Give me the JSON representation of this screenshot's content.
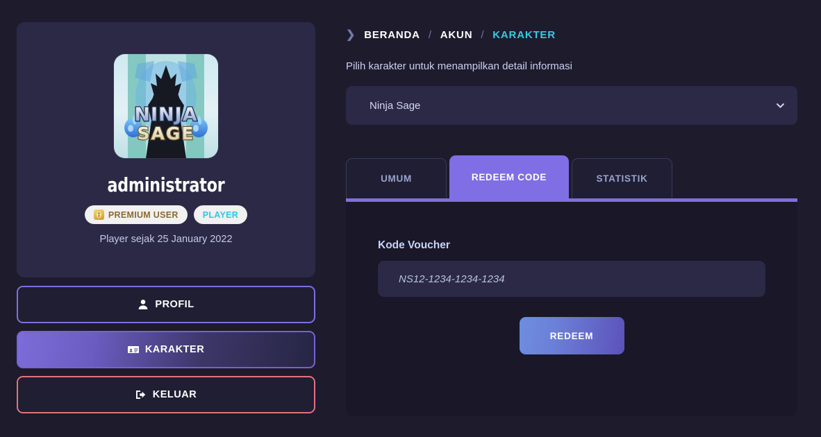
{
  "breadcrumb": {
    "chevron_icon": "chevron-right-icon",
    "items": [
      {
        "label": "BERANDA",
        "current": false
      },
      {
        "label": "AKUN",
        "current": false
      },
      {
        "label": "KARAKTER",
        "current": true
      }
    ],
    "separator": "/"
  },
  "profile": {
    "avatar_icon": "ninja-sage-game-avatar",
    "avatar_title_line1": "NINJA",
    "avatar_title_line2": "SAGE",
    "username": "administrator",
    "badges": [
      {
        "label": "PREMIUM USER",
        "icon": "gold-coin-icon",
        "color": "#8a6a34"
      },
      {
        "label": "PLAYER",
        "icon": "",
        "color": "#2fc6e8"
      }
    ],
    "since_text": "Player sejak 25 January 2022"
  },
  "nav": {
    "buttons": [
      {
        "label": "PROFIL",
        "icon": "user-icon",
        "state": "outline-purple"
      },
      {
        "label": "KARAKTER",
        "icon": "id-card-icon",
        "state": "active-purple"
      },
      {
        "label": "KELUAR",
        "icon": "sign-out-icon",
        "state": "outline-red"
      }
    ]
  },
  "main": {
    "helper_text": "Pilih karakter untuk menampilkan detail informasi",
    "character_select": {
      "selected": "Ninja Sage",
      "chevron_icon": "chevron-down-icon",
      "options": [
        "Ninja Sage"
      ]
    },
    "tabs": [
      {
        "label": "UMUM",
        "active": false
      },
      {
        "label": "REDEEM CODE",
        "active": true
      },
      {
        "label": "STATISTIK",
        "active": false
      }
    ],
    "redeem_panel": {
      "field_label": "Kode Voucher",
      "input_value": "",
      "input_placeholder": "NS12-1234-1234-1234",
      "submit_label": "REDEEM"
    }
  },
  "colors": {
    "page_bg": "#1e1b2d",
    "card_bg": "#2b2945",
    "panel_bg": "#191728",
    "accent_purple": "#7f6ee4",
    "accent_cyan": "#3cc9e0",
    "accent_red": "#e4727a",
    "gold": "#cf9b22"
  }
}
